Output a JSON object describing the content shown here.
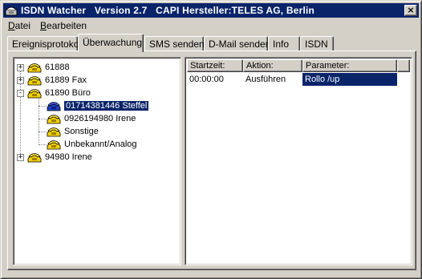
{
  "window": {
    "title": "ISDN Watcher   Version 2.7   CAPI Hersteller:TELES AG, Berlin",
    "close_label": "×"
  },
  "menu": {
    "items": [
      {
        "underline": "D",
        "rest": "atei"
      },
      {
        "underline": "B",
        "rest": "earbeiten"
      }
    ]
  },
  "tabs": [
    {
      "label": "Ereignisprotokoll",
      "active": false
    },
    {
      "label": "Überwachung",
      "active": true
    },
    {
      "label": "SMS senden",
      "active": false
    },
    {
      "label": "D-Mail senden",
      "active": false
    },
    {
      "label": "Info",
      "active": false
    },
    {
      "label": "ISDN",
      "active": false
    }
  ],
  "tree": {
    "nodes": [
      {
        "label": "61888",
        "level": 0,
        "expander": "+"
      },
      {
        "label": "61889 Fax",
        "level": 0,
        "expander": "+"
      },
      {
        "label": "61890 Büro",
        "level": 0,
        "expander": "-"
      },
      {
        "label": "01714381446 Steffel",
        "level": 1,
        "selected": true
      },
      {
        "label": "0926194980 Irene",
        "level": 1
      },
      {
        "label": "Sonstige",
        "level": 1
      },
      {
        "label": "Unbekannt/Analog",
        "level": 1
      },
      {
        "label": "94980 Irene",
        "level": 0,
        "expander": "+"
      }
    ]
  },
  "table": {
    "columns": [
      "Startzeit:",
      "Aktion:",
      "Parameter:"
    ],
    "rows": [
      [
        "00:00:00",
        "Ausführen",
        "Rollo /up"
      ]
    ]
  },
  "colors": {
    "titlebar": "#0a246a",
    "selection": "#0a246a",
    "face": "#d4d0c8",
    "phone_yellow": "#f0d000",
    "phone_blue": "#2040c0"
  }
}
